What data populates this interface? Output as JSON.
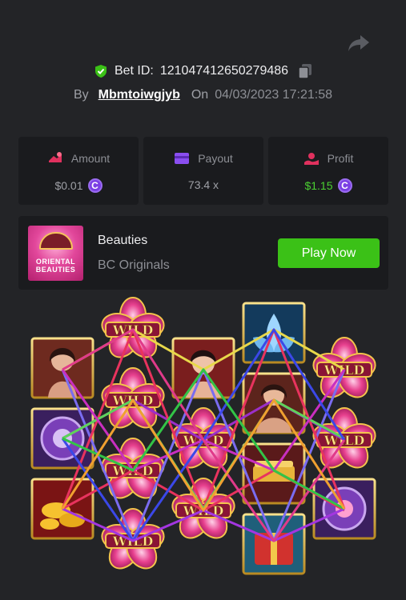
{
  "bet": {
    "label": "Bet ID:",
    "id": "121047412650279486",
    "by_label": "By",
    "username": "Mbmtoiwgjyb",
    "on_label": "On",
    "datetime": "04/03/2023 17:21:58"
  },
  "stats": {
    "amount": {
      "label": "Amount",
      "value": "$0.01"
    },
    "payout": {
      "label": "Payout",
      "value": "73.4 x"
    },
    "profit": {
      "label": "Profit",
      "value": "$1.15"
    }
  },
  "game": {
    "thumb_text": "ORIENTAL BEAUTIES",
    "name": "Beauties",
    "provider": "BC Originals",
    "play_label": "Play Now"
  },
  "reels": {
    "wild_label": "WILD",
    "columns": [
      [
        "portrait-woman",
        "purple-fan",
        "gold-ingots"
      ],
      [
        "wild",
        "wild",
        "wild",
        "wild"
      ],
      [
        "portrait-woman-red"
      ],
      [
        "wild",
        "wild"
      ],
      [
        "blue-lotus",
        "portrait-woman-flower",
        "gold-comb",
        "red-gift"
      ],
      [
        "wild",
        "wild",
        "purple-fan"
      ]
    ]
  },
  "colors": {
    "background": "#232427",
    "panel": "#1a1b1e",
    "accent_green": "#3bc117",
    "profit_green": "#4bd132",
    "coin_purple": "#7b3fe4"
  }
}
